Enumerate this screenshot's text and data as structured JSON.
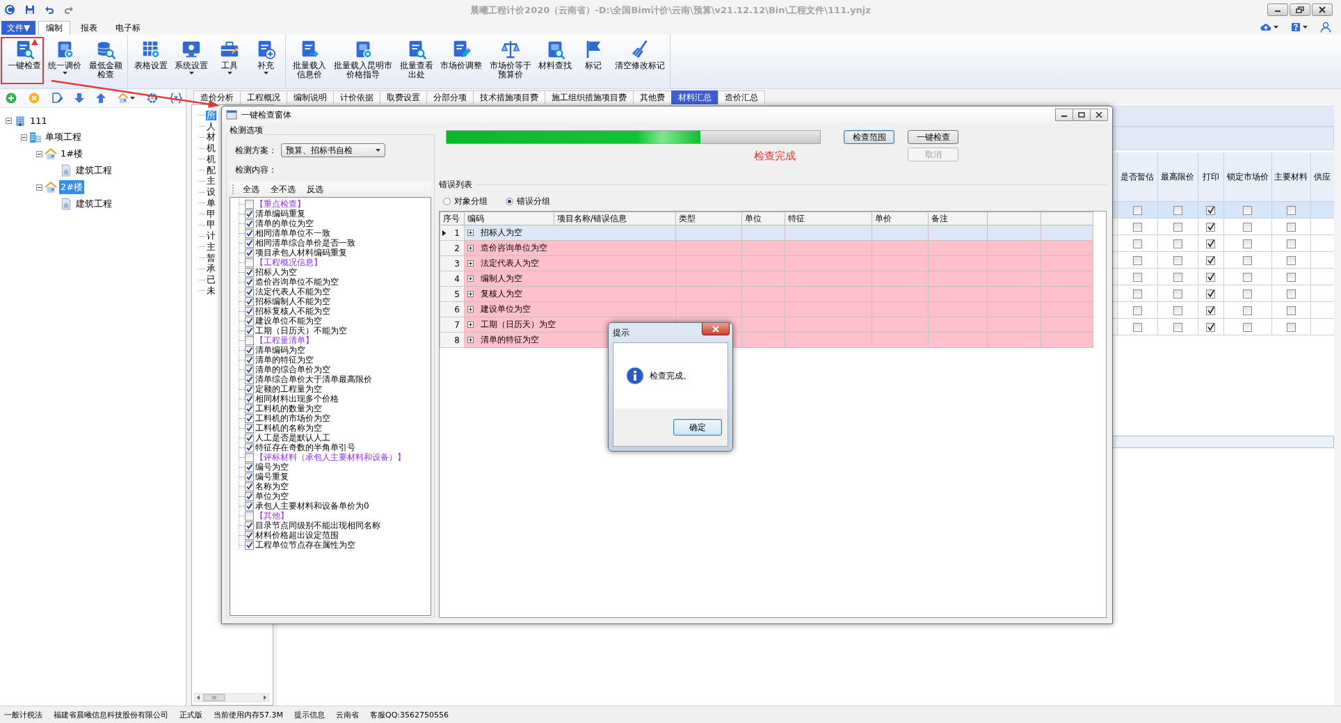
{
  "window": {
    "title": "晨曦工程计价2020（云南省）-D:\\全国Bim计价\\云南\\预算\\v21.12.12\\Bin\\工程文件\\111.ynjz"
  },
  "menu": {
    "file_button": "文件▼",
    "tabs": [
      {
        "label": "编制",
        "selected": true
      },
      {
        "label": "报表",
        "selected": false
      },
      {
        "label": "电子标",
        "selected": false
      }
    ]
  },
  "ribbon_groups": [
    {
      "buttons": [
        {
          "label": "一键检查",
          "dropdown": false
        },
        {
          "label": "统一调价",
          "dropdown": true
        },
        {
          "label": "最低金额检查",
          "dropdown": false
        }
      ]
    },
    {
      "buttons": [
        {
          "label": "表格设置",
          "dropdown": false
        },
        {
          "label": "系统设置",
          "dropdown": true
        },
        {
          "label": "工具",
          "dropdown": true
        },
        {
          "label": "补充",
          "dropdown": true
        }
      ]
    },
    {
      "buttons": [
        {
          "label": "批量载入信息价",
          "dropdown": false
        },
        {
          "label": "批量载入昆明市价格指导",
          "dropdown": false
        },
        {
          "label": "批量查看出处",
          "dropdown": false
        },
        {
          "label": "市场价调整",
          "dropdown": false
        },
        {
          "label": "市场价等于预算价",
          "dropdown": false
        },
        {
          "label": "材料查找",
          "dropdown": false
        },
        {
          "label": "标记",
          "dropdown": false
        },
        {
          "label": "清空修改标记",
          "dropdown": false
        }
      ]
    }
  ],
  "project_tree": [
    {
      "label": "111",
      "selected": false,
      "expanded": true,
      "children": [
        {
          "label": "单项工程",
          "selected": false,
          "expanded": true,
          "children": [
            {
              "label": "1#楼",
              "selected": false,
              "expanded": true,
              "children": [
                {
                  "label": "建筑工程",
                  "selected": false
                }
              ]
            },
            {
              "label": "2#楼",
              "selected": true,
              "expanded": true,
              "children": [
                {
                  "label": "建筑工程",
                  "selected": false
                }
              ]
            }
          ]
        }
      ]
    }
  ],
  "main_tabs": [
    {
      "label": "造价分析",
      "selected": false
    },
    {
      "label": "工程概况",
      "selected": false
    },
    {
      "label": "编制说明",
      "selected": false
    },
    {
      "label": "计价依据",
      "selected": false
    },
    {
      "label": "取费设置",
      "selected": false
    },
    {
      "label": "分部分项",
      "selected": false
    },
    {
      "label": "技术措施项目费",
      "selected": false
    },
    {
      "label": "施工组织措施项目费",
      "selected": false
    },
    {
      "label": "其他费",
      "selected": false
    },
    {
      "label": "材料汇总",
      "selected": true
    },
    {
      "label": "造价汇总",
      "selected": false
    }
  ],
  "material_categories": [
    {
      "label": "所",
      "selected": true
    },
    {
      "label": "人",
      "selected": false
    },
    {
      "label": "材",
      "selected": false
    },
    {
      "label": "机",
      "selected": false
    },
    {
      "label": "机",
      "selected": false
    },
    {
      "label": "配",
      "selected": false
    },
    {
      "label": "主",
      "selected": false
    },
    {
      "label": "设",
      "selected": false
    },
    {
      "label": "单",
      "selected": false
    },
    {
      "label": "甲",
      "selected": false
    },
    {
      "label": "甲",
      "selected": false
    },
    {
      "label": "计",
      "selected": false
    },
    {
      "label": "主",
      "selected": false
    },
    {
      "label": "暂",
      "selected": false
    },
    {
      "label": "承",
      "selected": false
    },
    {
      "label": "已",
      "selected": false
    },
    {
      "label": "未",
      "selected": false
    }
  ],
  "material_grid": {
    "columns": [
      "是否暂估",
      "最高限价",
      "打印",
      "锁定市场价",
      "主要材料",
      "供应"
    ],
    "rows": [
      {
        "selected": true,
        "estimate": false,
        "max_price": false,
        "print": true,
        "lock_price": false,
        "main_material": false
      },
      {
        "selected": false,
        "estimate": false,
        "max_price": false,
        "print": true,
        "lock_price": false,
        "main_material": false
      },
      {
        "selected": false,
        "estimate": false,
        "max_price": false,
        "print": true,
        "lock_price": false,
        "main_material": false
      },
      {
        "selected": false,
        "estimate": false,
        "max_price": false,
        "print": true,
        "lock_price": false,
        "main_material": false
      },
      {
        "selected": false,
        "estimate": false,
        "max_price": false,
        "print": true,
        "lock_price": false,
        "main_material": false
      },
      {
        "selected": false,
        "estimate": false,
        "max_price": false,
        "print": true,
        "lock_price": false,
        "main_material": false
      },
      {
        "selected": false,
        "estimate": false,
        "max_price": false,
        "print": true,
        "lock_price": false,
        "main_material": false
      },
      {
        "selected": false,
        "estimate": false,
        "max_price": false,
        "print": true,
        "lock_price": false,
        "main_material": false
      }
    ]
  },
  "check_dialog": {
    "title": "一键检查窗体",
    "options_group": "检测选项",
    "scheme_label": "检测方案：",
    "scheme_value": "预算、招标书自检",
    "content_label": "检测内容：",
    "list_actions": [
      "全选",
      "全不选",
      "反选"
    ],
    "check_items": [
      {
        "kind": "group",
        "label": "【重点检查】",
        "checked": false
      },
      {
        "kind": "check",
        "label": "清单编码重复",
        "checked": true
      },
      {
        "kind": "check",
        "label": "清单的单位为空",
        "checked": true
      },
      {
        "kind": "check",
        "label": "相同清单单位不一致",
        "checked": true
      },
      {
        "kind": "check",
        "label": "相同清单综合单价是否一致",
        "checked": true
      },
      {
        "kind": "check",
        "label": "项目承包人材料编码重复",
        "checked": true
      },
      {
        "kind": "group",
        "label": "【工程概况信息】",
        "checked": false
      },
      {
        "kind": "check",
        "label": "招标人为空",
        "checked": true
      },
      {
        "kind": "check",
        "label": "造价咨询单位不能为空",
        "checked": true
      },
      {
        "kind": "check",
        "label": "法定代表人不能为空",
        "checked": true
      },
      {
        "kind": "check",
        "label": "招标编制人不能为空",
        "checked": true
      },
      {
        "kind": "check",
        "label": "招标复核人不能为空",
        "checked": true
      },
      {
        "kind": "check",
        "label": "建设单位不能为空",
        "checked": true
      },
      {
        "kind": "check",
        "label": "工期（日历天）不能为空",
        "checked": true
      },
      {
        "kind": "group",
        "label": "【工程量清单】",
        "checked": false
      },
      {
        "kind": "check",
        "label": "清单编码为空",
        "checked": true
      },
      {
        "kind": "check",
        "label": "清单的特征为空",
        "checked": true
      },
      {
        "kind": "check",
        "label": "清单的综合单价为空",
        "checked": true
      },
      {
        "kind": "check",
        "label": "清单综合单价大于清单最高限价",
        "checked": true
      },
      {
        "kind": "check",
        "label": "定额的工程量为空",
        "checked": true
      },
      {
        "kind": "check",
        "label": "相同材料出现多个价格",
        "checked": true
      },
      {
        "kind": "check",
        "label": "工料机的数量为空",
        "checked": true
      },
      {
        "kind": "check",
        "label": "工料机的市场价为空",
        "checked": true
      },
      {
        "kind": "check",
        "label": "工料机的名称为空",
        "checked": true
      },
      {
        "kind": "check",
        "label": "人工是否是默认人工",
        "checked": true
      },
      {
        "kind": "check",
        "label": "特征存在奇数的半角单引号",
        "checked": true
      },
      {
        "kind": "group",
        "label": "【评标材料（承包人主要材料和设备）】",
        "checked": false
      },
      {
        "kind": "check",
        "label": "编号为空",
        "checked": true
      },
      {
        "kind": "check",
        "label": "编号重复",
        "checked": true
      },
      {
        "kind": "check",
        "label": "名称为空",
        "checked": true
      },
      {
        "kind": "check",
        "label": "单位为空",
        "checked": true
      },
      {
        "kind": "check",
        "label": "承包人主要材料和设备单价为0",
        "checked": true
      },
      {
        "kind": "group",
        "label": "【其他】",
        "checked": false
      },
      {
        "kind": "check",
        "label": "目录节点同级别不能出现相同名称",
        "checked": true
      },
      {
        "kind": "check",
        "label": "材料价格超出设定范围",
        "checked": true
      },
      {
        "kind": "check",
        "label": "工程单位节点存在属性为空",
        "checked": true
      }
    ],
    "progress": {
      "level": 0.68
    },
    "buttons": [
      {
        "label": "检查范围",
        "focused": true,
        "disabled": false
      },
      {
        "label": "一键检查",
        "focused": false,
        "disabled": false
      },
      {
        "label": "取消",
        "focused": false,
        "disabled": true
      }
    ],
    "status": "检查完成",
    "errors_group": "错误列表",
    "grouping": [
      {
        "label": "对象分组",
        "selected": false
      },
      {
        "label": "错误分组",
        "selected": true
      }
    ],
    "error_table": {
      "columns": [
        "序号",
        "编码",
        "项目名称/错误信息",
        "类型",
        "单位",
        "特征",
        "单价",
        "备注"
      ],
      "rows": [
        {
          "index": "1",
          "message": "招标人为空",
          "selected": true
        },
        {
          "index": "2",
          "message": "造价咨询单位为空",
          "selected": false
        },
        {
          "index": "3",
          "message": "法定代表人为空",
          "selected": false
        },
        {
          "index": "4",
          "message": "编制人为空",
          "selected": false
        },
        {
          "index": "5",
          "message": "复核人为空",
          "selected": false
        },
        {
          "index": "6",
          "message": "建设单位为空",
          "selected": false
        },
        {
          "index": "7",
          "message": "工期（日历天）为空",
          "selected": false
        },
        {
          "index": "8",
          "message": "清单的特征为空",
          "selected": false
        }
      ]
    }
  },
  "message_box": {
    "title": "提示",
    "message": "检查完成。",
    "button": "确定"
  },
  "status_bar": [
    "一般计税法",
    "福建省晨曦信息科技股份有限公司",
    "正式版",
    "当前使用内存57.3M",
    "提示信息",
    "云南省",
    "客服QQ:3562750556"
  ]
}
